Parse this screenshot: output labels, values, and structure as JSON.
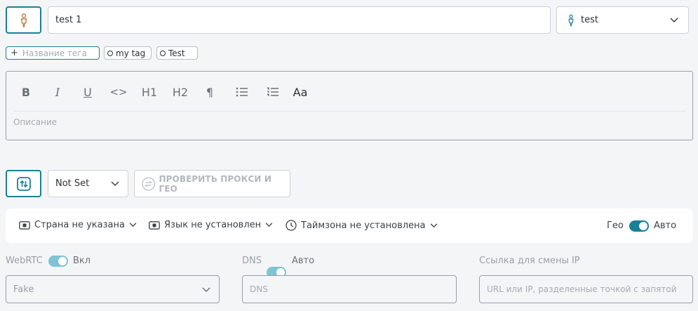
{
  "profile": {
    "name_value": "test 1",
    "owner_label": "test"
  },
  "tags": {
    "add_placeholder": "Название тега",
    "items": [
      "my tag",
      "Test"
    ]
  },
  "editor": {
    "toolbar": {
      "bold": "B",
      "italic": "I",
      "underline": "U",
      "code": "<>",
      "h1": "H1",
      "h2": "H2",
      "paragraph": "¶",
      "font": "Aa"
    },
    "placeholder": "Описание"
  },
  "proxy": {
    "type_value": "Not Set",
    "check_label": "ПРОВЕРИТЬ ПРОКСИ И ГЕО"
  },
  "geo": {
    "country": "Страна не указана",
    "language": "Язык не установлен",
    "timezone": "Таймзона не установлена",
    "geo_label": "Гео",
    "auto_label": "Авто",
    "auto_enabled": true
  },
  "webrtc": {
    "label": "WebRTC",
    "state": "Вкл",
    "value": "Fake",
    "enabled": true
  },
  "dns": {
    "label": "DNS",
    "state": "Авто",
    "placeholder": "DNS",
    "enabled": true
  },
  "ip_change": {
    "label": "Ссылка для смены IP",
    "placeholder": "URL или IP, разделенные точкой с запятой"
  },
  "colors": {
    "accent": "#1a7f99",
    "toggle_light": "#7fc3d6"
  }
}
